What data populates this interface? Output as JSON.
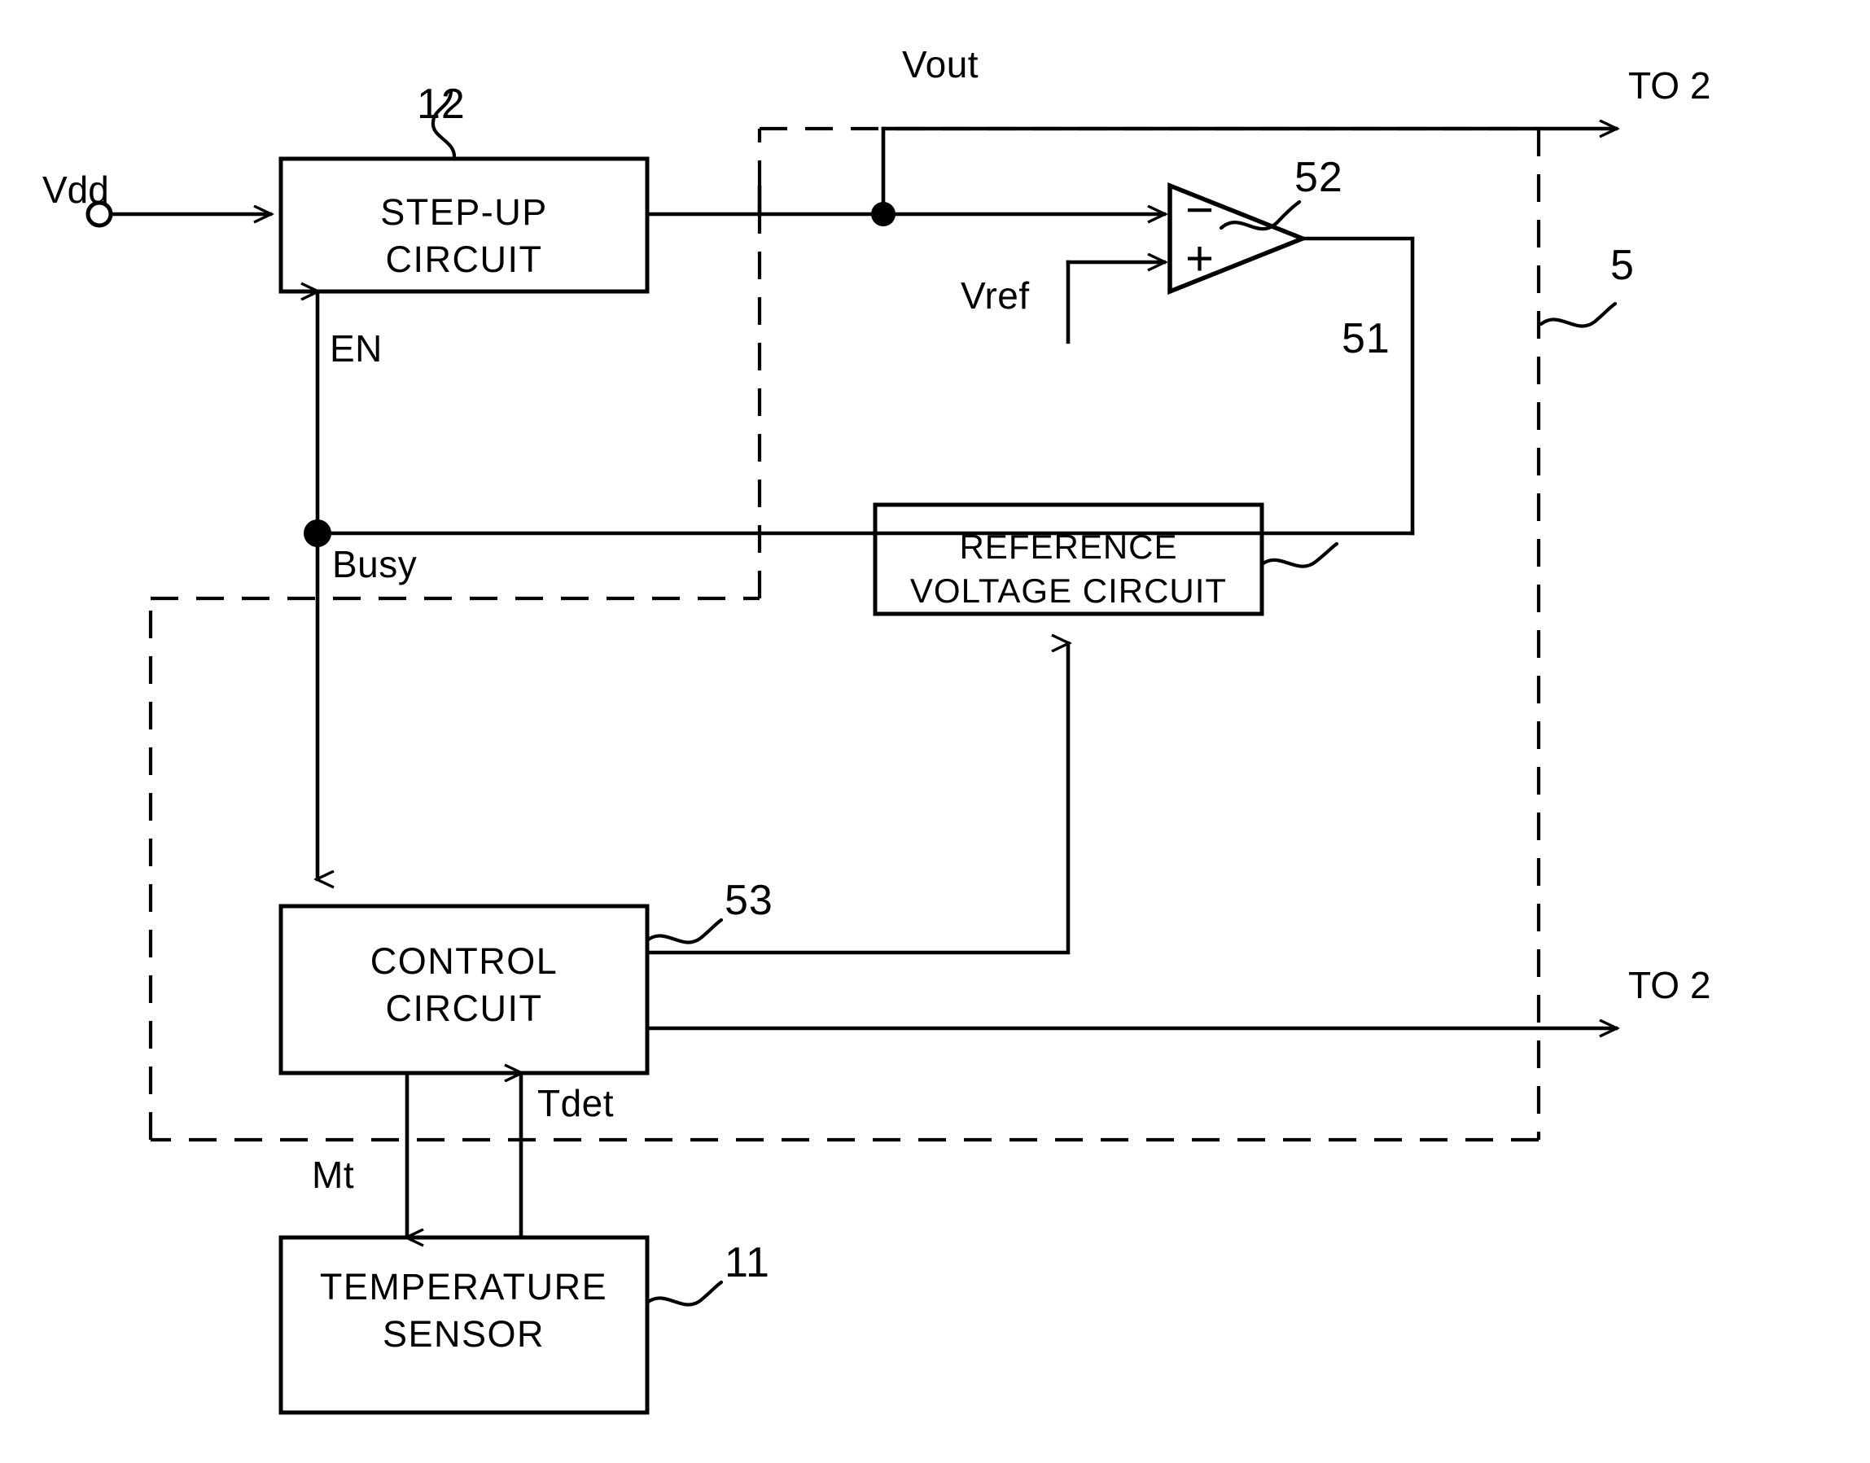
{
  "figure": {
    "type": "patent-block-diagram",
    "description": "Block diagram of a step-up power supply with temperature sensor feedback"
  },
  "terminals": {
    "supply_input": "Vdd",
    "output_node": "Vout",
    "dest_top": "TO 2",
    "dest_bottom": "TO 2"
  },
  "blocks": {
    "step_up": {
      "label": "STEP-UP\nCIRCUIT",
      "ref": "12"
    },
    "reference_voltage": {
      "label": "REFERENCE\nVOLTAGE CIRCUIT",
      "ref": "51"
    },
    "control": {
      "label": "CONTROL\nCIRCUIT",
      "ref": "53"
    },
    "temperature_sensor": {
      "label": "TEMPERATURE\nSENSOR",
      "ref": "11"
    },
    "comparator": {
      "ref": "52",
      "minus": "−",
      "plus": "+"
    }
  },
  "signals": {
    "enable": "EN",
    "busy": "Busy",
    "reference": "Vref",
    "temp_detect": "Tdet",
    "measure_trigger": "Mt"
  },
  "boundary": {
    "ref": "5"
  },
  "colors": {
    "line": "#000000",
    "background": "#ffffff"
  }
}
